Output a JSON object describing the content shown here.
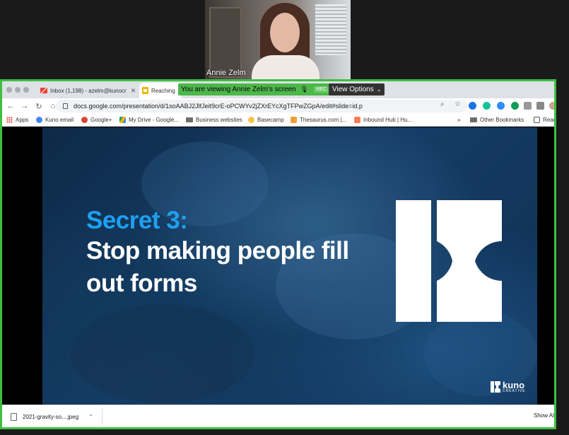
{
  "speaker": {
    "name": "Annie Zelm"
  },
  "banner": {
    "viewing_text": "You are viewing Annie Zelm's screen",
    "rec_label": "REC",
    "view_options_label": "View Options"
  },
  "browser": {
    "tabs": [
      {
        "title": "Inbox (1,198) - azelm@kunocr",
        "icon": "gmail-icon"
      },
      {
        "title": "Reaching",
        "icon": "slides-icon"
      }
    ],
    "url": "docs.google.com/presentation/d/1soAABJ2JlfJeit9crE-oPCWYv2jZXrEYcXgTFPwZGpA/edit#slide=id.p",
    "bookmarks": [
      {
        "label": "Apps",
        "icon": "apps-icon"
      },
      {
        "label": "Kuno email",
        "icon": "google-icon"
      },
      {
        "label": "Google+",
        "icon": "google-plus-icon"
      },
      {
        "label": "My Drive - Google...",
        "icon": "drive-icon"
      },
      {
        "label": "Business websites",
        "icon": "folder-icon"
      },
      {
        "label": "Basecamp",
        "icon": "basecamp-icon"
      },
      {
        "label": "Thesaurus.com |...",
        "icon": "thesaurus-icon"
      },
      {
        "label": "Inbound Hub | Hu...",
        "icon": "hubspot-icon"
      }
    ],
    "bookmarks_overflow": "»",
    "other_bookmarks": "Other Bookmarks",
    "reading_list": "Read"
  },
  "slide": {
    "heading": "Secret 3:",
    "body": "Stop making people fill out forms",
    "brand_name": "kuno",
    "brand_sub": "CREATIVE"
  },
  "downloads": {
    "file_name": "2021-gravity-so....jpeg",
    "show_all": "Show Al"
  }
}
